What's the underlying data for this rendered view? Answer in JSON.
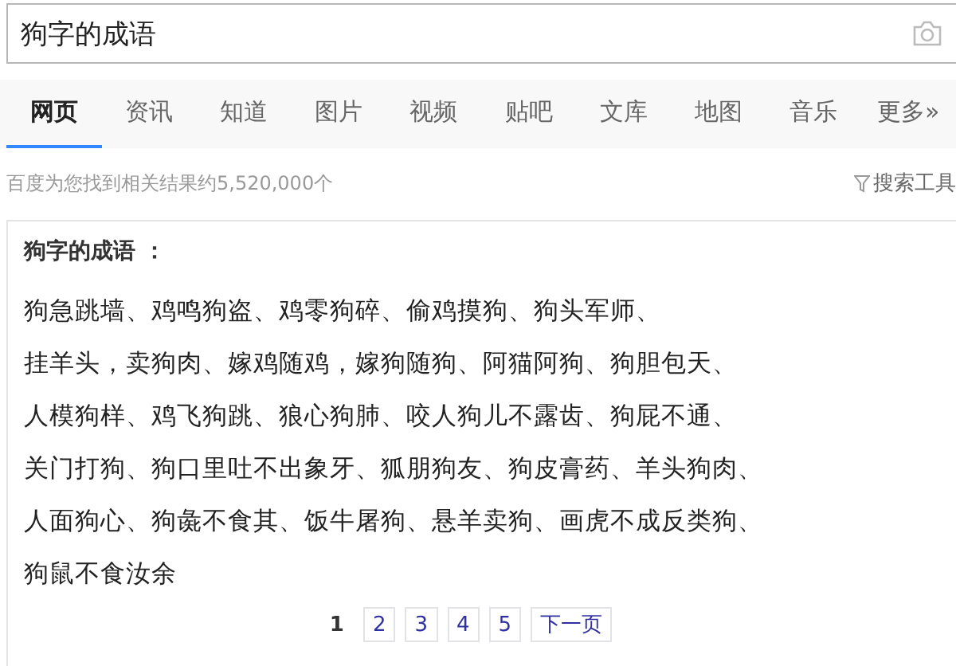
{
  "search": {
    "value": "狗字的成语"
  },
  "tabs": [
    {
      "label": "网页",
      "selected": true
    },
    {
      "label": "资讯",
      "selected": false
    },
    {
      "label": "知道",
      "selected": false
    },
    {
      "label": "图片",
      "selected": false
    },
    {
      "label": "视频",
      "selected": false
    },
    {
      "label": "贴吧",
      "selected": false
    },
    {
      "label": "文库",
      "selected": false
    },
    {
      "label": "地图",
      "selected": false
    },
    {
      "label": "音乐",
      "selected": false
    },
    {
      "label": "更多»",
      "selected": false
    }
  ],
  "result_count": "百度为您找到相关结果约5,520,000个",
  "search_tools": "搜索工具",
  "card": {
    "title": "狗字的成语 ：",
    "lines": [
      "狗急跳墙、鸡鸣狗盗、鸡零狗碎、偷鸡摸狗、狗头军师、",
      "挂羊头，卖狗肉、嫁鸡随鸡，嫁狗随狗、阿猫阿狗、狗胆包天、",
      "人模狗样、鸡飞狗跳、狼心狗肺、咬人狗儿不露齿、狗屁不通、",
      "关门打狗、狗口里吐不出象牙、狐朋狗友、狗皮膏药、羊头狗肉、",
      "人面狗心、狗彘不食其、饭牛屠狗、悬羊卖狗、画虎不成反类狗、",
      "狗鼠不食汝余"
    ]
  },
  "pagination": [
    {
      "label": "1",
      "selected": true
    },
    {
      "label": "2",
      "selected": false
    },
    {
      "label": "3",
      "selected": false
    },
    {
      "label": "4",
      "selected": false
    },
    {
      "label": "5",
      "selected": false
    },
    {
      "label": "下一页",
      "selected": false
    }
  ]
}
